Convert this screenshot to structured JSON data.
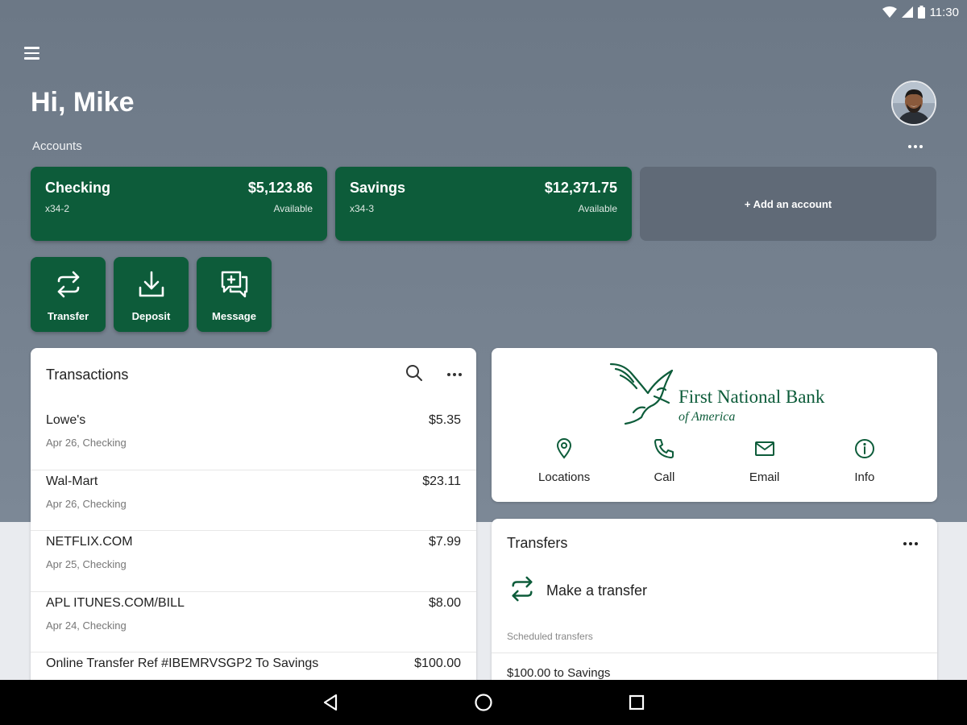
{
  "status_bar": {
    "time": "11:30",
    "icons": [
      "wifi-icon",
      "signal-icon",
      "battery-icon"
    ]
  },
  "header": {
    "greeting": "Hi, Mike",
    "menu_icon": "hamburger-menu-icon",
    "avatar_icon": "user-avatar"
  },
  "accounts": {
    "label": "Accounts",
    "items": [
      {
        "name": "Checking",
        "number": "x34-2",
        "balance": "$5,123.86",
        "balance_label": "Available"
      },
      {
        "name": "Savings",
        "number": "x34-3",
        "balance": "$12,371.75",
        "balance_label": "Available"
      }
    ],
    "add_label": "+ Add an account"
  },
  "quick_actions": [
    {
      "label": "Transfer",
      "icon": "transfer-arrows-icon"
    },
    {
      "label": "Deposit",
      "icon": "download-tray-icon"
    },
    {
      "label": "Message",
      "icon": "chat-plus-icon"
    }
  ],
  "transactions": {
    "title": "Transactions",
    "items": [
      {
        "merchant": "Lowe's",
        "amount": "$5.35",
        "detail": "Apr 26, Checking"
      },
      {
        "merchant": "Wal-Mart",
        "amount": "$23.11",
        "detail": "Apr 26, Checking"
      },
      {
        "merchant": "NETFLIX.COM",
        "amount": "$7.99",
        "detail": "Apr 25, Checking"
      },
      {
        "merchant": "APL ITUNES.COM/BILL",
        "amount": "$8.00",
        "detail": "Apr 24, Checking"
      },
      {
        "merchant": "Online Transfer Ref #IBEMRVSGP2 To Savings",
        "amount": "$100.00",
        "detail": ""
      }
    ]
  },
  "bank": {
    "name": "First National Bank",
    "subname": "of America",
    "actions": [
      {
        "label": "Locations",
        "icon": "location-pin-icon"
      },
      {
        "label": "Call",
        "icon": "phone-icon"
      },
      {
        "label": "Email",
        "icon": "email-envelope-icon"
      },
      {
        "label": "Info",
        "icon": "info-circle-icon"
      }
    ]
  },
  "transfers": {
    "title": "Transfers",
    "make_label": "Make a transfer",
    "scheduled_label": "Scheduled transfers",
    "scheduled": [
      {
        "label": "$100.00 to Savings"
      }
    ]
  },
  "colors": {
    "brand_green": "#0d5c3a",
    "hero_bg": "#717d8b",
    "add_card": "#606a77"
  }
}
